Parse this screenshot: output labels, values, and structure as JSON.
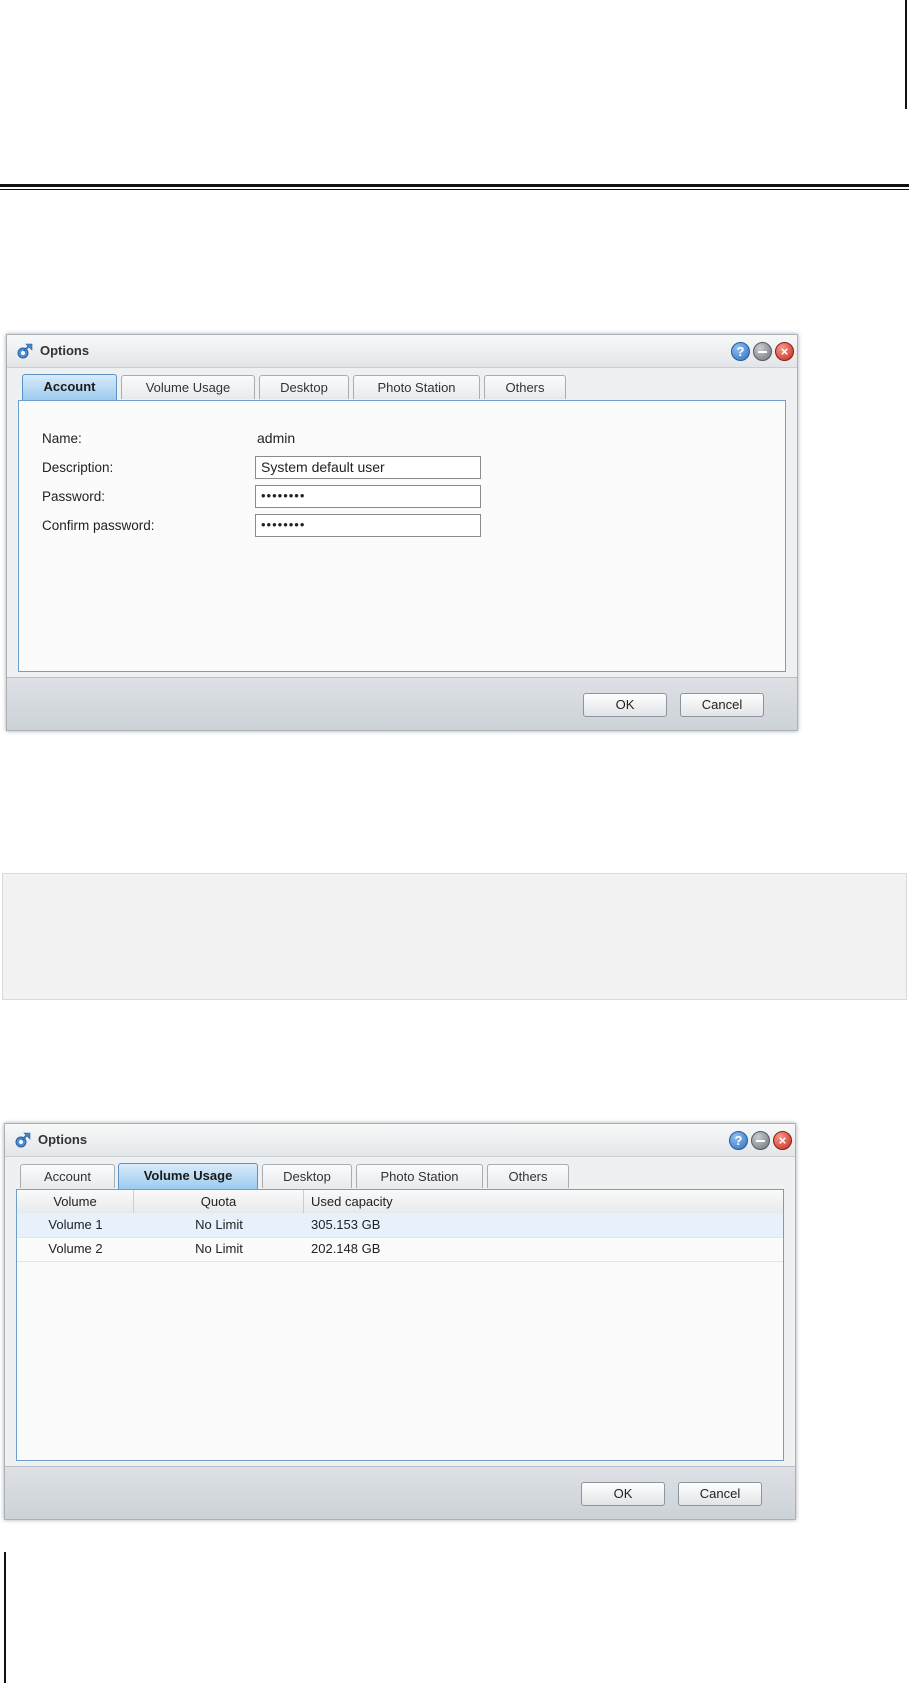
{
  "dialogs": [
    {
      "title": "Options",
      "tabs": [
        "Account",
        "Volume Usage",
        "Desktop",
        "Photo Station",
        "Others"
      ],
      "active_tab": "Account",
      "form": {
        "name_label": "Name:",
        "name_value": "admin",
        "description_label": "Description:",
        "description_value": "System default user",
        "password_label": "Password:",
        "password_value": "••••••••",
        "confirm_label": "Confirm password:",
        "confirm_value": "••••••••"
      },
      "buttons": {
        "ok": "OK",
        "cancel": "Cancel"
      }
    },
    {
      "title": "Options",
      "tabs": [
        "Account",
        "Volume Usage",
        "Desktop",
        "Photo Station",
        "Others"
      ],
      "active_tab": "Volume Usage",
      "table": {
        "headers": [
          "Volume",
          "Quota",
          "Used capacity"
        ],
        "rows": [
          [
            "Volume 1",
            "No Limit",
            "305.153 GB"
          ],
          [
            "Volume 2",
            "No Limit",
            "202.148 GB"
          ]
        ]
      },
      "buttons": {
        "ok": "OK",
        "cancel": "Cancel"
      }
    }
  ],
  "icons": {
    "app": "options-gear-icon",
    "help": "help-icon",
    "minimize": "minimize-icon",
    "close": "close-icon"
  }
}
